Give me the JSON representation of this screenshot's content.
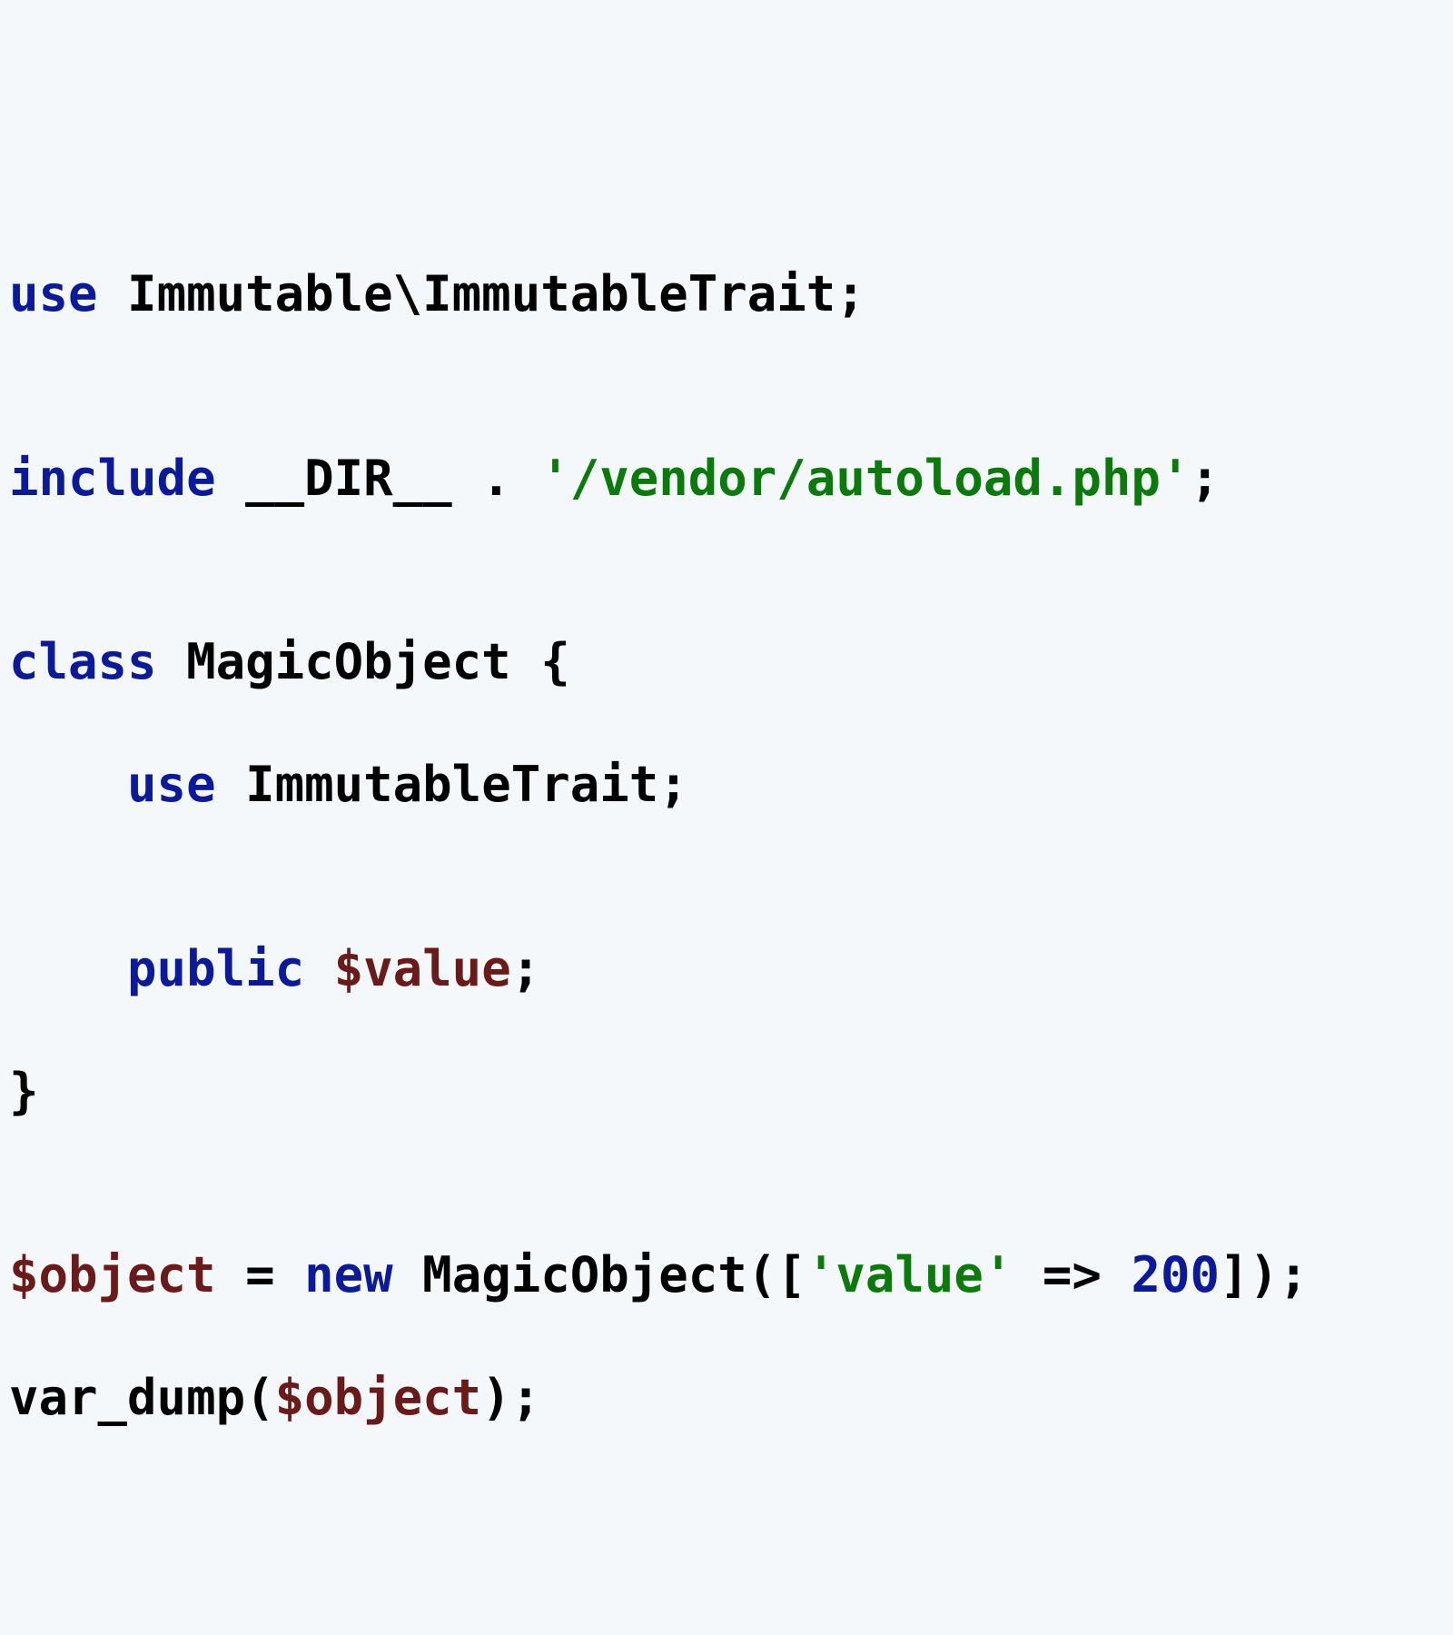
{
  "colors": {
    "keyword": "#0a1a9a",
    "string": "#0a7a0a",
    "variable": "#6b1a1a",
    "number": "#0a1a9a",
    "plain": "#000000",
    "background": "#f4f8fb"
  },
  "code": {
    "l1": {
      "kw": "use",
      "rest": " Immutable\\ImmutableTrait;"
    },
    "l2": "",
    "l3": {
      "kw": "include",
      "mid1": " ",
      "const": "__DIR__",
      "mid2": " . ",
      "str": "'/vendor/autoload.php'",
      "end": ";"
    },
    "l4": "",
    "l5": {
      "kw": "class",
      "rest": " MagicObject {"
    },
    "l6": {
      "indent": "    ",
      "kw": "use",
      "rest": " ImmutableTrait;"
    },
    "l7": "",
    "l8": {
      "indent": "    ",
      "kw": "public",
      "sp": " ",
      "var": "$value",
      "end": ";"
    },
    "l9": {
      "text": "}"
    },
    "l10": "",
    "l11": {
      "var1": "$object",
      "mid1": " = ",
      "kw": "new",
      "mid2": " MagicObject([",
      "str": "'value'",
      "mid3": " => ",
      "num": "200",
      "end": "]);"
    },
    "l12": {
      "fn": "var_dump(",
      "var": "$object",
      "end": ");"
    }
  }
}
